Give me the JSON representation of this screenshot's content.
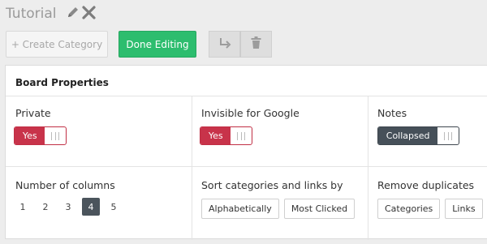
{
  "board": {
    "title": "Tutorial",
    "title_icons": [
      "pencil-icon",
      "close-icon"
    ]
  },
  "toolbar": {
    "create_category_label": "+ Create Category",
    "done_editing_label": "Done Editing",
    "move_icon": "move-arrow-icon",
    "delete_icon": "trash-icon"
  },
  "properties": {
    "heading": "Board Properties",
    "private": {
      "label": "Private",
      "toggle_text": "Yes"
    },
    "invisible_google": {
      "label": "Invisible for Google",
      "toggle_text": "Yes"
    },
    "notes": {
      "label": "Notes",
      "toggle_text": "Collapsed"
    },
    "columns": {
      "label": "Number of columns",
      "options": [
        "1",
        "2",
        "3",
        "4",
        "5"
      ],
      "selected": "4"
    },
    "sort": {
      "label": "Sort categories and links by",
      "options": [
        "Alphabetically",
        "Most Clicked"
      ]
    },
    "duplicates": {
      "label": "Remove duplicates",
      "options": [
        "Categories",
        "Links"
      ]
    }
  },
  "colors": {
    "done_green": "#2dbd6e",
    "toggle_red": "#c8334a",
    "toggle_dark": "#465059",
    "active_column": "#4b545c"
  }
}
